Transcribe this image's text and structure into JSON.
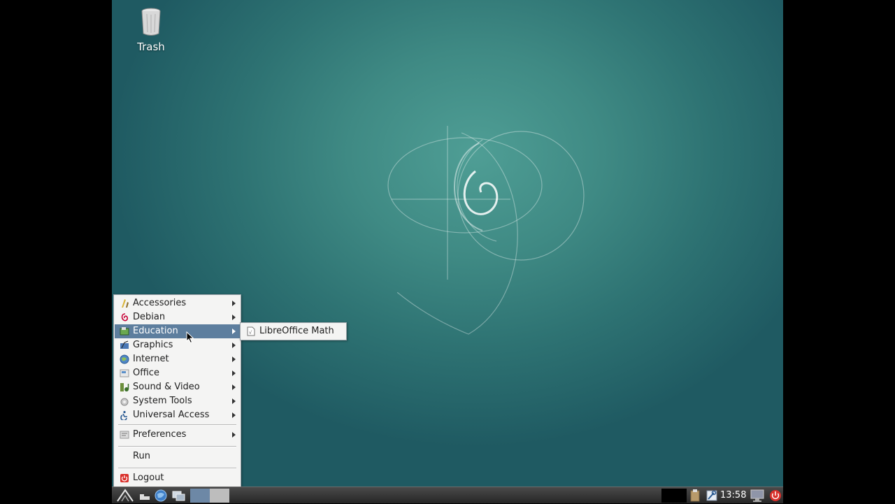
{
  "desktop": {
    "icons": [
      {
        "label": "Trash",
        "icon": "trash-icon"
      }
    ]
  },
  "menu": {
    "items": [
      {
        "label": "Accessories",
        "icon": "accessories-icon",
        "submenu": true
      },
      {
        "label": "Debian",
        "icon": "debian-swirl-icon",
        "submenu": true
      },
      {
        "label": "Education",
        "icon": "education-icon",
        "submenu": true,
        "active": true
      },
      {
        "label": "Graphics",
        "icon": "graphics-icon",
        "submenu": true
      },
      {
        "label": "Internet",
        "icon": "internet-globe-icon",
        "submenu": true
      },
      {
        "label": "Office",
        "icon": "office-icon",
        "submenu": true
      },
      {
        "label": "Sound & Video",
        "icon": "sound-video-icon",
        "submenu": true
      },
      {
        "label": "System Tools",
        "icon": "system-tools-icon",
        "submenu": true
      },
      {
        "label": "Universal Access",
        "icon": "universal-access-icon",
        "submenu": true
      }
    ],
    "preferences": {
      "label": "Preferences",
      "icon": "preferences-icon",
      "submenu": true
    },
    "run": {
      "label": "Run"
    },
    "logout": {
      "label": "Logout",
      "icon": "logout-icon"
    }
  },
  "submenu": {
    "items": [
      {
        "label": "LibreOffice Math",
        "icon": "libreoffice-math-icon"
      }
    ]
  },
  "taskbar": {
    "launchers": [
      "lxde-menu-icon",
      "minimize-all-icon",
      "web-browser-icon",
      "desktop-switch-icon"
    ],
    "clock": "13:58",
    "tray": [
      "clipboard-icon",
      "network-icon",
      "display-icon",
      "power-icon"
    ]
  },
  "colors": {
    "menu_highlight": "#5d7e9e",
    "desktop_teal": "#3f8a84",
    "panel_dark": "#262626",
    "logout_red": "#d9302b"
  }
}
